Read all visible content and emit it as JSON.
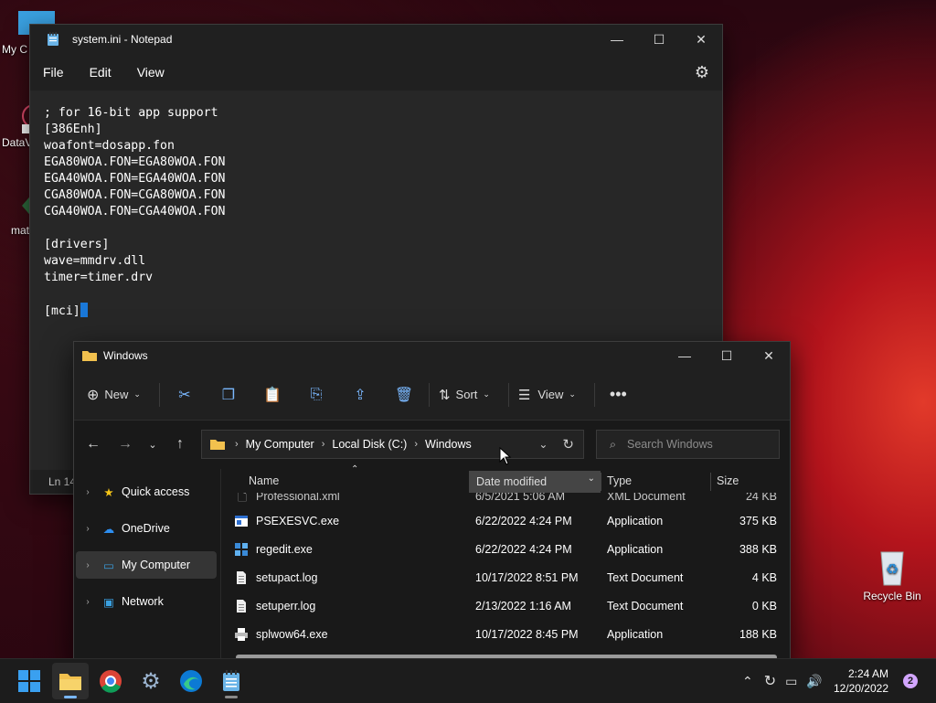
{
  "desktop": {
    "icons": [
      {
        "label": "My C"
      },
      {
        "label": "DataV"
      },
      {
        "label": "mat"
      },
      {
        "label": "Recycle Bin"
      }
    ]
  },
  "notepad": {
    "title": "system.ini - Notepad",
    "menu": [
      "File",
      "Edit",
      "View"
    ],
    "lines": [
      "; for 16-bit app support",
      "[386Enh]",
      "woafont=dosapp.fon",
      "EGA80WOA.FON=EGA80WOA.FON",
      "EGA40WOA.FON=EGA40WOA.FON",
      "CGA80WOA.FON=CGA80WOA.FON",
      "CGA40WOA.FON=CGA40WOA.FON",
      "",
      "[drivers]",
      "wave=mmdrv.dll",
      "timer=timer.drv",
      "",
      "[mci]"
    ],
    "status": "Ln 14"
  },
  "explorer": {
    "title": "Windows",
    "toolbar": {
      "new": "New",
      "sort": "Sort",
      "view": "View"
    },
    "breadcrumb": [
      "My Computer",
      "Local Disk (C:)",
      "Windows"
    ],
    "search_placeholder": "Search Windows",
    "nav": [
      {
        "label": "Quick access"
      },
      {
        "label": "OneDrive"
      },
      {
        "label": "My Computer"
      },
      {
        "label": "Network"
      }
    ],
    "columns": {
      "name": "Name",
      "date": "Date modified",
      "type": "Type",
      "size": "Size"
    },
    "files": [
      {
        "name": "Professional.xml",
        "date": "6/5/2021 5:06 AM",
        "type": "XML Document",
        "size": "24 KB"
      },
      {
        "name": "PSEXESVC.exe",
        "date": "6/22/2022 4:24 PM",
        "type": "Application",
        "size": "375 KB"
      },
      {
        "name": "regedit.exe",
        "date": "6/22/2022 4:24 PM",
        "type": "Application",
        "size": "388 KB"
      },
      {
        "name": "setupact.log",
        "date": "10/17/2022 8:51 PM",
        "type": "Text Document",
        "size": "4 KB"
      },
      {
        "name": "setuperr.log",
        "date": "2/13/2022 1:16 AM",
        "type": "Text Document",
        "size": "0 KB"
      },
      {
        "name": "splwow64.exe",
        "date": "10/17/2022 8:45 PM",
        "type": "Application",
        "size": "188 KB"
      }
    ]
  },
  "taskbar": {
    "time": "2:24 AM",
    "date": "12/20/2022",
    "notification_count": "2"
  },
  "colors": {
    "accent": "#7ab8ff",
    "caret": "#1a78d8",
    "wallpaper_red": "#b4141c"
  }
}
